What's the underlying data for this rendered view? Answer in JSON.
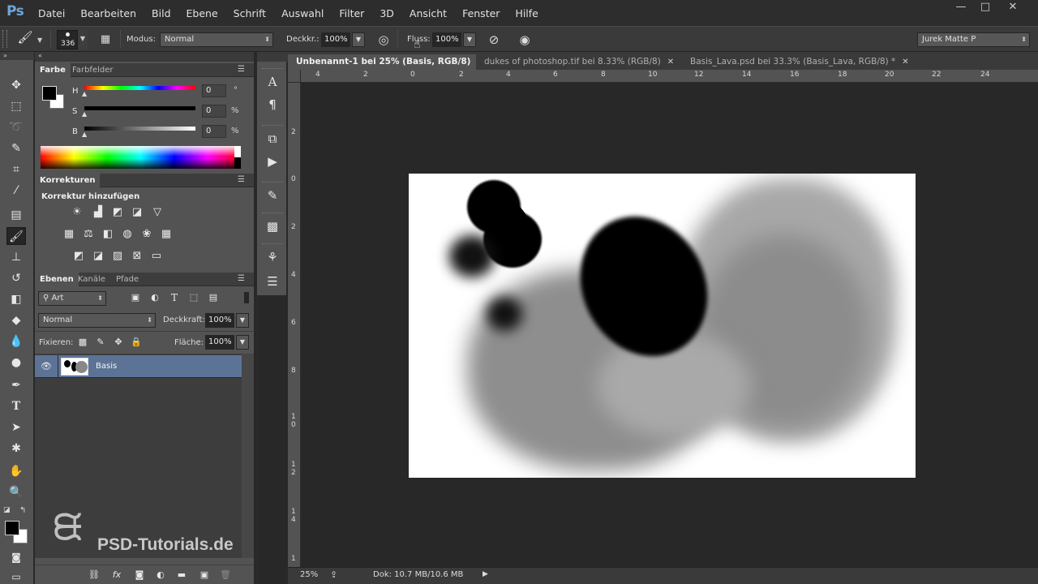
{
  "app": {
    "logo": "Ps"
  },
  "menu": [
    "Datei",
    "Bearbeiten",
    "Bild",
    "Ebene",
    "Schrift",
    "Auswahl",
    "Filter",
    "3D",
    "Ansicht",
    "Fenster",
    "Hilfe"
  ],
  "window_controls": {
    "minimize": "—",
    "restore": "□",
    "close": "✕"
  },
  "options": {
    "brush_size": "336",
    "mode_label": "Modus:",
    "mode_value": "Normal",
    "opacity_label": "Deckkr.:",
    "opacity_value": "100%",
    "flow_label": "Fluss:",
    "flow_value": "100%",
    "workspace": "Jurek Matte P"
  },
  "color_panel": {
    "tabs": [
      "Farbe",
      "Farbfelder"
    ],
    "sliders": [
      {
        "label": "H",
        "value": "0",
        "unit": "°"
      },
      {
        "label": "S",
        "value": "0",
        "unit": "%"
      },
      {
        "label": "B",
        "value": "0",
        "unit": "%"
      }
    ],
    "foreground": "#000000",
    "background": "#ffffff"
  },
  "adjustments_panel": {
    "tab": "Korrekturen",
    "title": "Korrektur hinzufügen"
  },
  "layers_panel": {
    "tabs": [
      "Ebenen",
      "Kanäle",
      "Pfade"
    ],
    "filter_label": "Art",
    "blend_mode": "Normal",
    "opacity_label": "Deckkraft:",
    "opacity_value": "100%",
    "lock_label": "Fixieren:",
    "fill_label": "Fläche:",
    "fill_value": "100%",
    "layers": [
      {
        "name": "Basis",
        "visible": true,
        "selected": true
      }
    ]
  },
  "watermark": "PSD-Tutorials.de",
  "documents": [
    {
      "title": "Unbenannt-1 bei 25% (Basis, RGB/8) *",
      "active": true
    },
    {
      "title": "dukes of photoshop.tif bei 8.33% (RGB/8)",
      "active": false
    },
    {
      "title": "Basis_Lava.psd bei 33.3% (Basis_Lava, RGB/8) *",
      "active": false
    }
  ],
  "ruler": {
    "h_labels": [
      "4",
      "2",
      "0",
      "2",
      "4",
      "6",
      "8",
      "10",
      "12",
      "14",
      "16",
      "18",
      "20",
      "22",
      "24"
    ],
    "v_labels": [
      "2",
      "0",
      "2",
      "4",
      "6",
      "8",
      "1\n0",
      "1\n2",
      "1\n4",
      "1"
    ]
  },
  "status": {
    "zoom": "25%",
    "doc_size": "Dok: 10.7 MB/10.6 MB"
  },
  "colors": {
    "accent_layer": "#5c7396",
    "ui_dark": "#282828",
    "panel": "#535353"
  }
}
